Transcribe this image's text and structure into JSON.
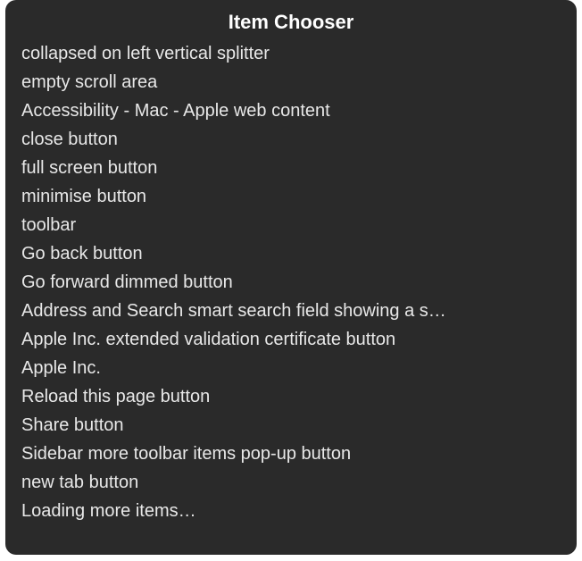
{
  "title": "Item Chooser",
  "items": [
    "collapsed on left vertical splitter",
    "empty scroll area",
    "Accessibility - Mac - Apple web content",
    "close button",
    "full screen button",
    "minimise button",
    "toolbar",
    "Go back button",
    "Go forward dimmed button",
    "Address and Search smart search field showing a s…",
    "Apple Inc. extended validation certificate button",
    "Apple Inc.",
    "Reload this page button",
    "Share button",
    "Sidebar more toolbar items pop-up button",
    "new tab button",
    "Loading more items…"
  ]
}
